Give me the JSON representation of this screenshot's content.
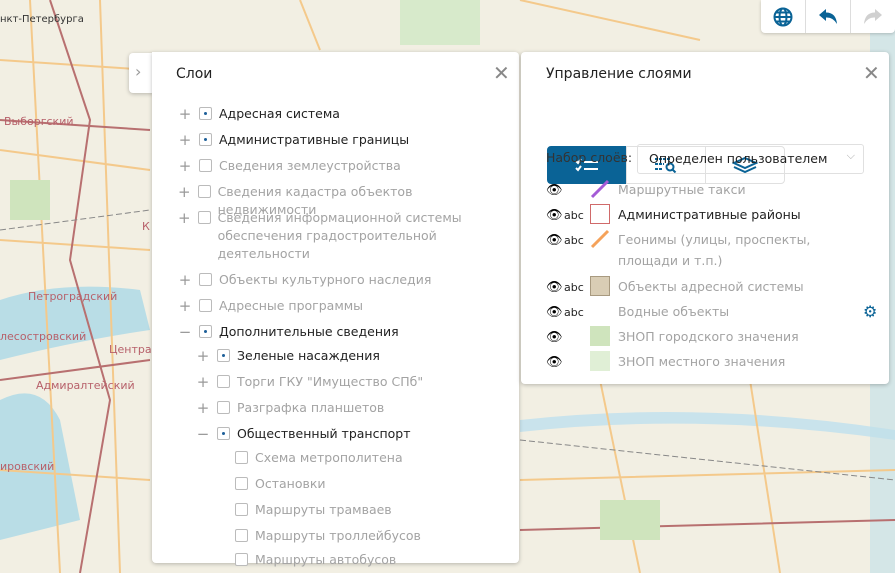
{
  "map": {
    "city_label": "нкт-Петербурга",
    "districts": [
      "Выборгский",
      "Петроградский",
      "лесостровский",
      "Централ",
      "Адмиралтейский",
      "ировский",
      "К"
    ]
  },
  "toolbar": {
    "icons": [
      "globe-icon",
      "undo-icon",
      "redo-icon"
    ]
  },
  "layers_panel": {
    "title": "Слои",
    "items": [
      {
        "label": "Адресная система",
        "checked": true,
        "level": 0,
        "expander": "+"
      },
      {
        "label": "Административные границы",
        "checked": true,
        "level": 0,
        "expander": "+"
      },
      {
        "label": "Сведения землеустройства",
        "checked": false,
        "level": 0,
        "expander": "+"
      },
      {
        "label": "Сведения кадастра объектов недвижимости",
        "checked": false,
        "level": 0,
        "expander": "+"
      },
      {
        "label": "Сведения информационной системы обеспечения градостроительной деятельности",
        "checked": false,
        "level": 0,
        "expander": "+"
      },
      {
        "label": "Объекты культурного наследия",
        "checked": false,
        "level": 0,
        "expander": "+"
      },
      {
        "label": "Адресные программы",
        "checked": false,
        "level": 0,
        "expander": "+"
      },
      {
        "label": "Дополнительные сведения",
        "checked": true,
        "level": 0,
        "expander": "−"
      },
      {
        "label": "Зеленые насаждения",
        "checked": true,
        "level": 1,
        "expander": "+"
      },
      {
        "label": "Торги ГКУ \"Имущество СПб\"",
        "checked": false,
        "level": 1,
        "expander": "+"
      },
      {
        "label": "Разграфка планшетов",
        "checked": false,
        "level": 1,
        "expander": "+"
      },
      {
        "label": "Общественный транспорт",
        "checked": true,
        "level": 1,
        "expander": "−"
      },
      {
        "label": "Схема метрополитена",
        "checked": false,
        "level": 2,
        "expander": ""
      },
      {
        "label": "Остановки",
        "checked": false,
        "level": 2,
        "expander": ""
      },
      {
        "label": "Маршруты трамваев",
        "checked": false,
        "level": 2,
        "expander": ""
      },
      {
        "label": "Маршруты троллейбусов",
        "checked": false,
        "level": 2,
        "expander": ""
      },
      {
        "label": "Маршруты автобусов",
        "checked": false,
        "level": 2,
        "expander": ""
      }
    ]
  },
  "manage_panel": {
    "title": "Управление слоями",
    "tabs": [
      "list-check-icon",
      "filter-search-icon",
      "layers-icon"
    ],
    "active_tab": 0,
    "set_label": "Набор слоёв:",
    "set_value": "Определен пользователем",
    "accent": "#0a6396",
    "layers": [
      {
        "label": "Маршрутные такси",
        "abc": "",
        "active": false,
        "symbol": "line",
        "color": "#a45bd6"
      },
      {
        "label": "Административные районы",
        "abc": "abc",
        "active": true,
        "symbol": "box",
        "color": "#d06a6a"
      },
      {
        "label": "Геонимы (улицы, проспекты, площади и т.п.)",
        "abc": "abc",
        "active": false,
        "symbol": "line",
        "color": "#f5a25a"
      },
      {
        "label": "Объекты адресной системы",
        "abc": "abc",
        "active": false,
        "symbol": "fill",
        "color": "#d9cdb5"
      },
      {
        "label": "Водные объекты",
        "abc": "abc",
        "active": false,
        "symbol": "none",
        "color": ""
      },
      {
        "label": "ЗНОП городского значения",
        "abc": "",
        "active": false,
        "symbol": "fill",
        "color": "#cfe4bd"
      },
      {
        "label": "ЗНОП местного значения",
        "abc": "",
        "active": false,
        "symbol": "fill",
        "color": "#e0efd6"
      }
    ]
  }
}
